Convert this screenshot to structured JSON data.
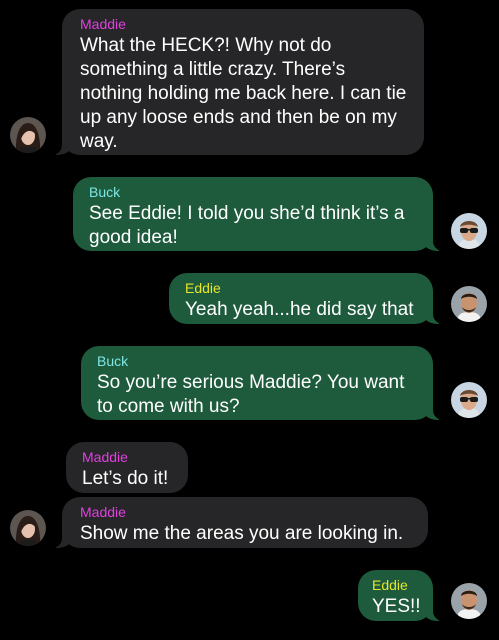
{
  "colors": {
    "background": "#000000",
    "incoming_bubble": "#262628",
    "outgoing_bubble": "#1e5b3c",
    "maddie_name": "#e040e0",
    "buck_name": "#7de6e6",
    "eddie_name": "#e6e62a",
    "text": "#ffffff"
  },
  "messages": [
    {
      "sender": "Maddie",
      "text": "What the HECK?! Why not do something a little crazy. There’s nothing holding me back here. I can tie up any loose ends and then be on my way."
    },
    {
      "sender": "Buck",
      "text": "See Eddie! I told you she’d think it’s a good idea!"
    },
    {
      "sender": "Eddie",
      "text": "Yeah yeah...he did say that"
    },
    {
      "sender": "Buck",
      "text": "So you’re serious Maddie? You want to come with us?"
    },
    {
      "sender": "Maddie",
      "text": "Let’s do it!"
    },
    {
      "sender": "Maddie",
      "text": "Show me the areas you are looking in."
    },
    {
      "sender": "Eddie",
      "text": "YES!!"
    }
  ],
  "avatars": {
    "maddie": "maddie-avatar",
    "buck": "buck-avatar",
    "eddie": "eddie-avatar"
  }
}
